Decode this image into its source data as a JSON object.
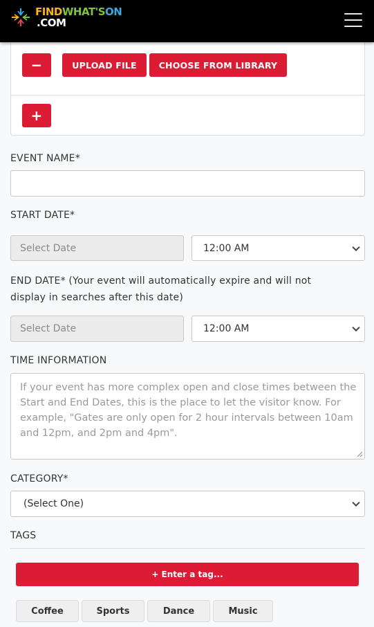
{
  "header": {
    "logo": {
      "line1_parts": [
        {
          "text": "FIND ",
          "color": "#f5b316"
        },
        {
          "text": "WHAT'S ",
          "color": "#7dc242"
        },
        {
          "text": "ON",
          "color": "#3aa8e0"
        }
      ],
      "line2": ".COM",
      "mark_colors": {
        "top": "#3aa8e0",
        "left": "#f5b316",
        "right": "#7dc242",
        "bottom": "#e8424f"
      }
    },
    "menu_icon": "hamburger-menu-icon"
  },
  "media": {
    "remove_label": "−",
    "upload_label": "UPLOAD FILE",
    "library_label": "CHOOSE FROM LIBRARY",
    "add_label": "+"
  },
  "form": {
    "event_name": {
      "label": "EVENT NAME*",
      "value": ""
    },
    "start_date": {
      "label": "START DATE*",
      "date_placeholder": "Select Date",
      "time_value": "12:00 AM"
    },
    "end_date": {
      "label_line1": "END DATE* (Your event will automatically expire and will not",
      "label_line2": "display in searches after this date)",
      "date_placeholder": "Select Date",
      "time_value": "12:00 AM"
    },
    "time_information": {
      "label": "TIME INFORMATION",
      "placeholder": "If your event has more complex open and close times between the Start and End Dates, this is the place to let the visitor know. For example, \"Gates are only open for 2 hour intervals between 10am and 12pm, and 2pm and 4pm\"."
    },
    "category": {
      "label": "CATEGORY*",
      "value": "(Select One)"
    },
    "tags": {
      "label": "TAGS",
      "enter_tag_label": "+ Enter a tag...",
      "suggestions": [
        "Coffee",
        "Sports",
        "Dance",
        "Music"
      ]
    }
  },
  "colors": {
    "accent": "#dc1c35",
    "header_bg": "#000000",
    "page_bg": "#f8f9fb"
  }
}
